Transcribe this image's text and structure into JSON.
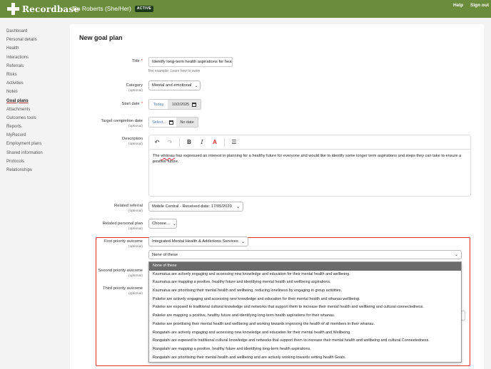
{
  "header": {
    "brand": "Recordbase",
    "patient_name": "Tia Roberts (She/Her)",
    "status_badge": "ACTIVE",
    "help": "Help",
    "sign_out": "Sign out"
  },
  "sidebar": {
    "items": [
      {
        "label": "Dashboard"
      },
      {
        "label": "Personal details"
      },
      {
        "label": "Health"
      },
      {
        "label": "Interactions"
      },
      {
        "label": "Referrals"
      },
      {
        "label": "Risks"
      },
      {
        "label": "Activities"
      },
      {
        "label": "Notes"
      },
      {
        "label": "Goal plans",
        "active": true
      },
      {
        "label": "Attachments"
      },
      {
        "label": "Outcomes tools"
      },
      {
        "label": "Reports"
      },
      {
        "label": "MyRecord"
      },
      {
        "label": "Employment plans"
      },
      {
        "label": "Shared information"
      },
      {
        "label": "Protocols"
      },
      {
        "label": "Relationships"
      }
    ]
  },
  "form": {
    "page_title": "New goal plan",
    "optional": "(optional)",
    "required_mark": "*",
    "title": {
      "label": "Title",
      "value": "Identify long-term health aspirations for heal",
      "hint": "For example: Learn how to swim"
    },
    "category": {
      "label": "Category",
      "value": "Mental and emotional"
    },
    "start_date": {
      "label": "Start date",
      "today": "Today",
      "value": "10/2/2025"
    },
    "target_date": {
      "label": "Target completion date",
      "placeholder": "Select...",
      "no_date": "No date"
    },
    "description": {
      "label": "Description",
      "text_before": "The ",
      "text_spell": "whānau",
      "text_after": " has expressed an interest in planning for a healthy future for everyone and would like to identify some longer term aspirations and steps they can take to ensure a positive future."
    },
    "related_referral": {
      "label": "Related referral",
      "value": "Mobile Central - Received date: 17/05/2020"
    },
    "related_plan": {
      "label": "Related personal plan",
      "value": "Choose..."
    },
    "first_priority": {
      "label": "First priority outcome",
      "service": "Integrated Mental Health & Addictions Services",
      "value": "None of these"
    },
    "second_priority": {
      "label": "Second priority outcome"
    },
    "third_priority": {
      "label": "Third priority outcome"
    }
  },
  "dropdown": {
    "options": [
      "None of these",
      "Kaumatua are actively engaging and accessing new knowledge and education for their mental health and wellbeing.",
      "Kaumatua are mapping a positive, healthy future and identifying mental health and wellbeing aspirations.",
      "Kaumatua are prioritising their mental health and wellbeing, reducing loneliness by engaging in group activities.",
      "Pakeke are actively engaging and accessing new knowledge and education for their mental health and whanau wellbeing.",
      "Pakeke are exposed to traditional cultural knowledge and networks that support them to increase their mental health and wellbeing and cultural connectedness.",
      "Pakeke are mapping a positive, healthy future and identifying long-term health aspirations for their whanau.",
      "Pakeke are prioritising their mental health and wellbeing and working towards improving the health of all members in their whanau.",
      "Rangatahi are actively engaging and accessing new knowledge and education for their mental health and Wellbeing.",
      "Rangatahi are exposed to traditional cultural knowledge and networks that support them to increase their mental health and wellbeing and cultural Connectedness.",
      "Rangatahi are mapping a positive, healthy future and identifying long-term health aspirations.",
      "Rangatahi are prioritising their mental health and wellbeing and are actively working towards setting health Goals."
    ],
    "selected_index": 0
  },
  "icons": {
    "undo": "undo-icon",
    "redo": "redo-icon",
    "bold": "bold-icon",
    "italic": "italic-icon",
    "text_color": "text-color-icon",
    "bullet_list": "bullet-list-icon",
    "calendar": "calendar-icon"
  },
  "colors": {
    "brand_green": "#6b8c3c",
    "highlight_red": "#e0302a",
    "text_color_icon": "#d32f2f"
  }
}
